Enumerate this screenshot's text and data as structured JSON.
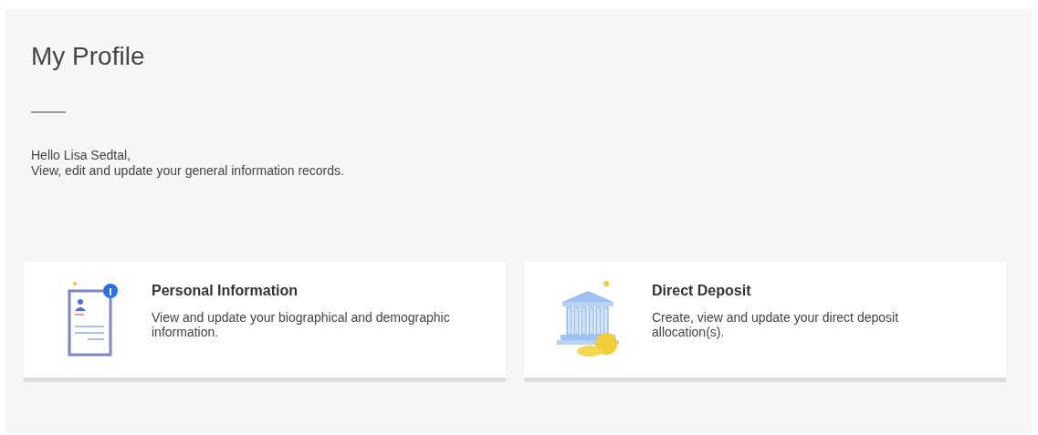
{
  "page": {
    "title": "My Profile",
    "greeting": "Hello Lisa Sedtal,",
    "subtitle": "View, edit and update your general information records."
  },
  "cards": [
    {
      "kind": "profile",
      "title": "Personal Information",
      "description": "View and update your biographical and demographic information."
    },
    {
      "kind": "bank",
      "title": "Direct Deposit",
      "description": "Create, view and update your direct deposit allocation(s)."
    }
  ]
}
